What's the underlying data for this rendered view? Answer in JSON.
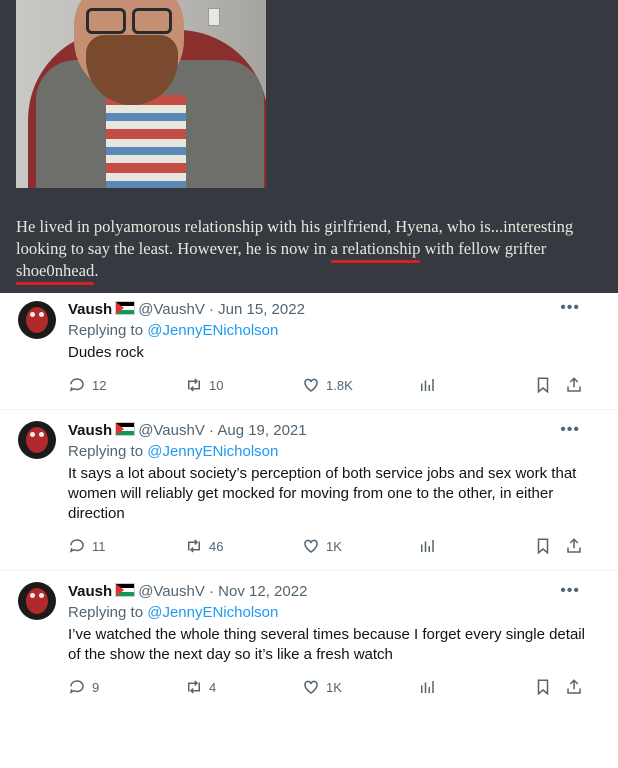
{
  "caption": {
    "part1": "He lived in polyamorous relationship with his girlfriend, Hyena, who is...interesting looking to say the least. However, he is now in ",
    "link1": "a relationship",
    "part2": " with fellow grifter ",
    "link2": "shoe0nhead",
    "part3": "."
  },
  "tweets": [
    {
      "name": "Vaush",
      "handle": "@VaushV",
      "date": "· Jun 15, 2022",
      "replying_prefix": "Replying to ",
      "replying_to": "@JennyENicholson",
      "text": "Dudes rock",
      "replies": "12",
      "retweets": "10",
      "likes": "1.8K"
    },
    {
      "name": "Vaush",
      "handle": "@VaushV",
      "date": "· Aug 19, 2021",
      "replying_prefix": "Replying to ",
      "replying_to": "@JennyENicholson",
      "text": "It says a lot about society’s perception of both service jobs and sex work that women will reliably get mocked for moving from one to the other, in either direction",
      "replies": "11",
      "retweets": "46",
      "likes": "1K"
    },
    {
      "name": "Vaush",
      "handle": "@VaushV",
      "date": "· Nov 12, 2022",
      "replying_prefix": "Replying to ",
      "replying_to": "@JennyENicholson",
      "text": "I’ve watched the whole thing several times because I forget every single detail of the show the next day so it’s like a fresh watch",
      "replies": "9",
      "retweets": "4",
      "likes": "1K"
    }
  ],
  "more_label": "•••",
  "colors": {
    "accent": "#1d9bf0",
    "underline": "#d52121",
    "panel": "#36393f"
  }
}
